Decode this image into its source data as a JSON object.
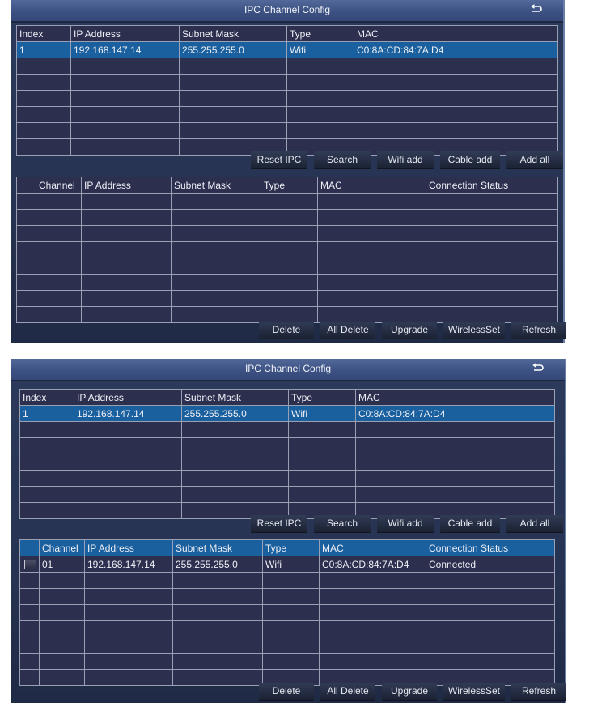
{
  "window": {
    "title": "IPC Channel Config",
    "back_icon": "return-arrow-icon"
  },
  "search_table": {
    "columns": [
      "Index",
      "IP Address",
      "Subnet Mask",
      "Type",
      "MAC"
    ],
    "rows": [
      [
        "1",
        "192.168.147.14",
        "255.255.255.0",
        "Wifi",
        "C0:8A:CD:84:7A:D4"
      ]
    ],
    "selected_row": 0
  },
  "search_buttons": [
    "Reset IPC",
    "Search",
    "Wifi add",
    "Cable add",
    "Add all"
  ],
  "channel_table": {
    "columns": [
      "",
      "Channel",
      "IP Address",
      "Subnet Mask",
      "Type",
      "MAC",
      "Connection Status"
    ]
  },
  "channel_buttons": [
    "Delete",
    "All Delete",
    "Upgrade",
    "WirelessSet",
    "Refresh"
  ],
  "panel1": {
    "channel_rows": []
  },
  "panel2": {
    "channel_rows": [
      {
        "checked": false,
        "cells": [
          "01",
          "192.168.147.14",
          "255.255.255.0",
          "Wifi",
          "C0:8A:CD:84:7A:D4",
          "Connected"
        ]
      }
    ]
  }
}
